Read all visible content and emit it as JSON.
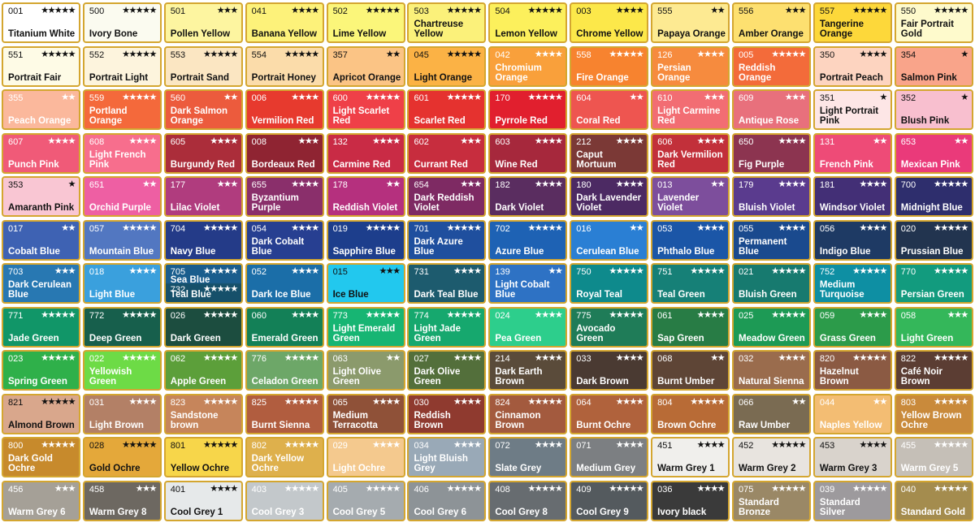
{
  "swatches": [
    {
      "code": "001",
      "stars": "★★★★★",
      "name": "Titanium White",
      "color": "#ffffff",
      "text": "light"
    },
    {
      "code": "500",
      "stars": "★★★★★",
      "name": "Ivory Bone",
      "color": "#fbfbf0",
      "text": "light"
    },
    {
      "code": "501",
      "stars": "★★★",
      "name": "Pollen Yellow",
      "color": "#fdf5a0",
      "text": "light"
    },
    {
      "code": "041",
      "stars": "★★★★",
      "name": "Banana Yellow",
      "color": "#fdf27a",
      "text": "light"
    },
    {
      "code": "502",
      "stars": "★★★★★",
      "name": "Lime Yellow",
      "color": "#fbf67a",
      "text": "light"
    },
    {
      "code": "503",
      "stars": "★★★★★",
      "name": "Chartreuse Yellow",
      "color": "#fbf17a",
      "text": "light"
    },
    {
      "code": "504",
      "stars": "★★★★★",
      "name": "Lemon Yellow",
      "color": "#fcf05c",
      "text": "light"
    },
    {
      "code": "003",
      "stars": "★★★★",
      "name": "Chrome Yellow",
      "color": "#fce84a",
      "text": "light"
    },
    {
      "code": "555",
      "stars": "★★",
      "name": "Papaya Orange",
      "color": "#fdea92",
      "text": "light"
    },
    {
      "code": "556",
      "stars": "★★★",
      "name": "Amber Orange",
      "color": "#fde070",
      "text": "light"
    },
    {
      "code": "557",
      "stars": "★★★★★",
      "name": "Tangerine Orange",
      "color": "#fdd83a",
      "text": "light"
    },
    {
      "code": "550",
      "stars": "★★★★★",
      "name": "Fair Portrait Gold",
      "color": "#fefacc",
      "text": "light"
    },
    {
      "code": "551",
      "stars": "★★★★★",
      "name": "Portrait Fair",
      "color": "#fefbe6",
      "text": "light"
    },
    {
      "code": "552",
      "stars": "★★★★★",
      "name": "Portrait Light",
      "color": "#fdf4dd",
      "text": "light"
    },
    {
      "code": "553",
      "stars": "★★★★★",
      "name": "Portrait Sand",
      "color": "#fbe6c2",
      "text": "light"
    },
    {
      "code": "554",
      "stars": "★★★★★",
      "name": "Portrait Honey",
      "color": "#fbdcaa",
      "text": "light"
    },
    {
      "code": "357",
      "stars": "★★",
      "name": "Apricot Orange",
      "color": "#fbc485",
      "text": "light"
    },
    {
      "code": "045",
      "stars": "★★★★★",
      "name": "Light Orange",
      "color": "#fbb245",
      "text": "light"
    },
    {
      "code": "042",
      "stars": "★★★★",
      "name": "Chromium Orange",
      "color": "#f9a03b",
      "text": "dark"
    },
    {
      "code": "558",
      "stars": "★★★★★",
      "name": "Fire Orange",
      "color": "#f7832f",
      "text": "dark"
    },
    {
      "code": "126",
      "stars": "★★★★",
      "name": "Persian Orange",
      "color": "#f68b3e",
      "text": "dark"
    },
    {
      "code": "005",
      "stars": "★★★★★",
      "name": "Reddish Orange",
      "color": "#f36b3a",
      "text": "dark"
    },
    {
      "code": "350",
      "stars": "★★★★",
      "name": "Portrait Peach",
      "color": "#fdd4c0",
      "text": "light"
    },
    {
      "code": "354",
      "stars": "★",
      "name": "Salmon Pink",
      "color": "#f9a48a",
      "text": "light"
    },
    {
      "code": "355",
      "stars": "★★",
      "name": "Peach Orange",
      "color": "#fbb89c",
      "text": "dark"
    },
    {
      "code": "559",
      "stars": "★★★★★",
      "name": "Portland Orange",
      "color": "#f4693b",
      "text": "dark"
    },
    {
      "code": "560",
      "stars": "★★",
      "name": "Dark Salmon Orange",
      "color": "#ec5b3d",
      "text": "dark"
    },
    {
      "code": "006",
      "stars": "★★★★",
      "name": "Vermilion Red",
      "color": "#e73a2e",
      "text": "dark"
    },
    {
      "code": "600",
      "stars": "★★★★★",
      "name": "Light Scarlet Red",
      "color": "#ef4048",
      "text": "dark"
    },
    {
      "code": "601",
      "stars": "★★★★★",
      "name": "Scarlet Red",
      "color": "#e5322f",
      "text": "dark"
    },
    {
      "code": "170",
      "stars": "★★★★★",
      "name": "Pyrrole Red",
      "color": "#e11f2e",
      "text": "dark"
    },
    {
      "code": "604",
      "stars": "★★",
      "name": "Coral Red",
      "color": "#ee5550",
      "text": "dark"
    },
    {
      "code": "610",
      "stars": "★★★",
      "name": "Light Carmine Red",
      "color": "#f26d73",
      "text": "dark"
    },
    {
      "code": "609",
      "stars": "★★★",
      "name": "Antique Rose",
      "color": "#e8707c",
      "text": "dark"
    },
    {
      "code": "351",
      "stars": "★",
      "name": "Light Portrait Pink",
      "color": "#fde6e6",
      "text": "light"
    },
    {
      "code": "352",
      "stars": "★",
      "name": "Blush Pink",
      "color": "#f8bfcf",
      "text": "light"
    },
    {
      "code": "607",
      "stars": "★★★★",
      "name": "Punch Pink",
      "color": "#f05a78",
      "text": "dark"
    },
    {
      "code": "608",
      "stars": "★★★★",
      "name": "Light French Pink",
      "color": "#f76e8d",
      "text": "dark"
    },
    {
      "code": "605",
      "stars": "★★★★",
      "name": "Burgundy Red",
      "color": "#ab2d3a",
      "text": "dark"
    },
    {
      "code": "008",
      "stars": "★★★",
      "name": "Bordeaux Red",
      "color": "#8f2432",
      "text": "dark"
    },
    {
      "code": "132",
      "stars": "★★★★",
      "name": "Carmine Red",
      "color": "#c92b45",
      "text": "dark"
    },
    {
      "code": "602",
      "stars": "★★★",
      "name": "Currant Red",
      "color": "#c72d3e",
      "text": "dark"
    },
    {
      "code": "603",
      "stars": "★★★★",
      "name": "Wine Red",
      "color": "#a6283c",
      "text": "dark"
    },
    {
      "code": "212",
      "stars": "★★★★",
      "name": "Caput Mortuum",
      "color": "#7b3936",
      "text": "dark"
    },
    {
      "code": "606",
      "stars": "★★★★",
      "name": "Dark Vermilion Red",
      "color": "#c2303a",
      "text": "dark"
    },
    {
      "code": "650",
      "stars": "★★★★",
      "name": "Fig Purple",
      "color": "#8c3450",
      "text": "dark"
    },
    {
      "code": "131",
      "stars": "★★",
      "name": "French Pink",
      "color": "#ee4b77",
      "text": "dark"
    },
    {
      "code": "653",
      "stars": "★★",
      "name": "Mexican Pink",
      "color": "#ea3a7a",
      "text": "dark"
    },
    {
      "code": "353",
      "stars": "★",
      "name": "Amaranth Pink",
      "color": "#f9c6d3",
      "text": "light"
    },
    {
      "code": "651",
      "stars": "★★",
      "name": "Orchid Purple",
      "color": "#ee5fa3",
      "text": "dark"
    },
    {
      "code": "177",
      "stars": "★★★",
      "name": "Lilac Violet",
      "color": "#b03c7e",
      "text": "dark"
    },
    {
      "code": "655",
      "stars": "★★★★",
      "name": "Byzantium Purple",
      "color": "#8a2f6b",
      "text": "dark"
    },
    {
      "code": "178",
      "stars": "★★",
      "name": "Reddish Violet",
      "color": "#b5307e",
      "text": "dark"
    },
    {
      "code": "654",
      "stars": "★★★",
      "name": "Dark Reddish Violet",
      "color": "#7e2a63",
      "text": "dark"
    },
    {
      "code": "182",
      "stars": "★★★★",
      "name": "Dark Violet",
      "color": "#5a2d60",
      "text": "dark"
    },
    {
      "code": "180",
      "stars": "★★★★",
      "name": "Dark Lavender Violet",
      "color": "#4c2a63",
      "text": "dark"
    },
    {
      "code": "013",
      "stars": "★★",
      "name": "Lavender Violet",
      "color": "#7d4e9c",
      "text": "dark"
    },
    {
      "code": "179",
      "stars": "★★★★",
      "name": "Bluish Violet",
      "color": "#5a3b8e",
      "text": "dark"
    },
    {
      "code": "181",
      "stars": "★★★★",
      "name": "Windsor Violet",
      "color": "#432f76",
      "text": "dark"
    },
    {
      "code": "700",
      "stars": "★★★★★",
      "name": "Midnight Blue",
      "color": "#2e2e6d",
      "text": "dark"
    },
    {
      "code": "017",
      "stars": "★★",
      "name": "Cobalt Blue",
      "color": "#3e62b3",
      "text": "dark"
    },
    {
      "code": "057",
      "stars": "★★★★★",
      "name": "Mountain Blue",
      "color": "#5277c1",
      "text": "dark"
    },
    {
      "code": "704",
      "stars": "★★★★★",
      "name": "Navy Blue",
      "color": "#243b88",
      "text": "dark"
    },
    {
      "code": "054",
      "stars": "★★★★",
      "name": "Dark Cobalt Blue",
      "color": "#273f91",
      "text": "dark"
    },
    {
      "code": "019",
      "stars": "★★★★★",
      "name": "Sapphire Blue",
      "color": "#1d3e8c",
      "text": "dark"
    },
    {
      "code": "701",
      "stars": "★★★★★",
      "name": "Dark Azure Blue",
      "color": "#1f4f9e",
      "text": "dark"
    },
    {
      "code": "702",
      "stars": "★★★★★",
      "name": "Azure Blue",
      "color": "#1e62b4",
      "text": "dark"
    },
    {
      "code": "016",
      "stars": "★★",
      "name": "Cerulean Blue",
      "color": "#2a7fd4",
      "text": "dark"
    },
    {
      "code": "053",
      "stars": "★★★★",
      "name": "Phthalo Blue",
      "color": "#1b56a7",
      "text": "dark"
    },
    {
      "code": "055",
      "stars": "★★★★",
      "name": "Permanent Blue",
      "color": "#1a4a8e",
      "text": "dark"
    },
    {
      "code": "056",
      "stars": "★★★★",
      "name": "Indigo Blue",
      "color": "#1e3a64",
      "text": "dark"
    },
    {
      "code": "020",
      "stars": "★★★★★",
      "name": "Prussian Blue",
      "color": "#22344f",
      "text": "dark"
    },
    {
      "code": "703",
      "stars": "★★★",
      "name": "Dark Cerulean Blue",
      "color": "#2878b2",
      "text": "dark"
    },
    {
      "code": "018",
      "stars": "★★★★",
      "name": "Light Blue",
      "color": "#3aa0dd",
      "text": "dark"
    },
    {
      "code": "705",
      "stars": "★★★★★",
      "name": "Sea Blue",
      "code2": "732",
      "stars2": "★★★★★",
      "name2": "Teal Blue",
      "color": "#1a5d8d",
      "color2": "#16506a",
      "text": "dark",
      "dual": true
    },
    {
      "code": "052",
      "stars": "★★★★",
      "name": "Dark Ice Blue",
      "color": "#1b6ea8",
      "text": "dark"
    },
    {
      "code": "015",
      "stars": "★★★",
      "name": "Ice Blue",
      "color": "#22c8ee",
      "text": "light"
    },
    {
      "code": "731",
      "stars": "★★★★",
      "name": "Dark Teal Blue",
      "color": "#1d5b6e",
      "text": "dark"
    },
    {
      "code": "139",
      "stars": "★★",
      "name": "Light Cobalt Blue",
      "color": "#2e72c4",
      "text": "dark"
    },
    {
      "code": "750",
      "stars": "★★★★★",
      "name": "Royal Teal",
      "color": "#0e8a8c",
      "text": "dark"
    },
    {
      "code": "751",
      "stars": "★★★★★",
      "name": "Teal Green",
      "color": "#168077",
      "text": "dark"
    },
    {
      "code": "021",
      "stars": "★★★★★",
      "name": "Bluish Green",
      "color": "#177a6f",
      "text": "dark"
    },
    {
      "code": "752",
      "stars": "★★★★★",
      "name": "Medium Turquoise",
      "color": "#0e8fa3",
      "text": "dark"
    },
    {
      "code": "770",
      "stars": "★★★★★",
      "name": "Persian Green",
      "color": "#129b7e",
      "text": "dark"
    },
    {
      "code": "771",
      "stars": "★★★★★",
      "name": "Jade Green",
      "color": "#119668",
      "text": "dark"
    },
    {
      "code": "772",
      "stars": "★★★★★",
      "name": "Deep Green",
      "color": "#175f4c",
      "text": "dark"
    },
    {
      "code": "026",
      "stars": "★★★★★",
      "name": "Dark Green",
      "color": "#1c4d3f",
      "text": "dark"
    },
    {
      "code": "060",
      "stars": "★★★★",
      "name": "Emerald Green",
      "color": "#138057",
      "text": "dark"
    },
    {
      "code": "773",
      "stars": "★★★★★",
      "name": "Light Emerald Green",
      "color": "#17b573",
      "text": "dark"
    },
    {
      "code": "774",
      "stars": "★★★★★",
      "name": "Light Jade Green",
      "color": "#16a86e",
      "text": "dark"
    },
    {
      "code": "024",
      "stars": "★★★★",
      "name": "Pea Green",
      "color": "#2dce8c",
      "text": "dark"
    },
    {
      "code": "775",
      "stars": "★★★★★",
      "name": "Avocado Green",
      "color": "#1f7c58",
      "text": "dark"
    },
    {
      "code": "061",
      "stars": "★★★★",
      "name": "Sap Green",
      "color": "#287c45",
      "text": "dark"
    },
    {
      "code": "025",
      "stars": "★★★★★",
      "name": "Meadow Green",
      "color": "#1d9a55",
      "text": "dark"
    },
    {
      "code": "059",
      "stars": "★★★★",
      "name": "Grass Green",
      "color": "#2c9b4a",
      "text": "dark"
    },
    {
      "code": "058",
      "stars": "★★★",
      "name": "Light Green",
      "color": "#34b75a",
      "text": "dark"
    },
    {
      "code": "023",
      "stars": "★★★★★",
      "name": "Spring Green",
      "color": "#2fb04a",
      "text": "dark"
    },
    {
      "code": "022",
      "stars": "★★★★★",
      "name": "Yellowish Green",
      "color": "#6ddb46",
      "text": "dark"
    },
    {
      "code": "062",
      "stars": "★★★★★",
      "name": "Apple Green",
      "color": "#5c9f3a",
      "text": "dark"
    },
    {
      "code": "776",
      "stars": "★★★★★",
      "name": "Celadon Green",
      "color": "#6da768",
      "text": "dark"
    },
    {
      "code": "063",
      "stars": "★★",
      "name": "Light  Olive Green",
      "color": "#8b9a6c",
      "text": "dark"
    },
    {
      "code": "027",
      "stars": "★★★★",
      "name": "Dark Olive Green",
      "color": "#536f3b",
      "text": "dark"
    },
    {
      "code": "214",
      "stars": "★★★★",
      "name": "Dark Earth Brown",
      "color": "#5a4b3a",
      "text": "dark"
    },
    {
      "code": "033",
      "stars": "★★★★",
      "name": "Dark Brown",
      "color": "#4a3a32",
      "text": "dark"
    },
    {
      "code": "068",
      "stars": "★★",
      "name": "Burnt Umber",
      "color": "#5e4536",
      "text": "dark"
    },
    {
      "code": "032",
      "stars": "★★★★",
      "name": "Natural Sienna",
      "color": "#9a6c4d",
      "text": "dark"
    },
    {
      "code": "820",
      "stars": "★★★★★",
      "name": "Hazelnut Brown",
      "color": "#8b5a43",
      "text": "dark"
    },
    {
      "code": "822",
      "stars": "★★★★★",
      "name": "Café Noir Brown",
      "color": "#5b3d33",
      "text": "dark"
    },
    {
      "code": "821",
      "stars": "★★★★★",
      "name": "Almond Brown",
      "color": "#d9a78c",
      "text": "light"
    },
    {
      "code": "031",
      "stars": "★★★★",
      "name": "Light Brown",
      "color": "#b38066",
      "text": "dark"
    },
    {
      "code": "823",
      "stars": "★★★★★",
      "name": "Sandstone brown",
      "color": "#c6855b",
      "text": "dark"
    },
    {
      "code": "825",
      "stars": "★★★★★",
      "name": "Burnt Sienna",
      "color": "#b15d3f",
      "text": "dark"
    },
    {
      "code": "065",
      "stars": "★★★★",
      "name": "Medium Terracotta",
      "color": "#8f5138",
      "text": "dark"
    },
    {
      "code": "030",
      "stars": "★★★★",
      "name": "Reddish Brown",
      "color": "#8f3a2f",
      "text": "dark"
    },
    {
      "code": "824",
      "stars": "★★★★★",
      "name": "Cinnamon Brown",
      "color": "#a35a3e",
      "text": "dark"
    },
    {
      "code": "064",
      "stars": "★★★★",
      "name": "Burnt Ochre",
      "color": "#b0623c",
      "text": "dark"
    },
    {
      "code": "804",
      "stars": "★★★★★",
      "name": "Brown Ochre",
      "color": "#b86b36",
      "text": "dark"
    },
    {
      "code": "066",
      "stars": "★★",
      "name": "Raw Umber",
      "color": "#7a6b52",
      "text": "dark"
    },
    {
      "code": "044",
      "stars": "★★",
      "name": "Naples Yellow",
      "color": "#f3bd73",
      "text": "dark"
    },
    {
      "code": "803",
      "stars": "★★★★★",
      "name": "Yellow Brown Ochre",
      "color": "#c98a3b",
      "text": "dark"
    },
    {
      "code": "800",
      "stars": "★★★★★",
      "name": "Dark Gold Ochre",
      "color": "#c78a2c",
      "text": "dark"
    },
    {
      "code": "028",
      "stars": "★★★★★",
      "name": "Gold Ochre",
      "color": "#e4a83a",
      "text": "light"
    },
    {
      "code": "801",
      "stars": "★★★★★",
      "name": "Yellow Ochre",
      "color": "#f7d64a",
      "text": "light"
    },
    {
      "code": "802",
      "stars": "★★★★★",
      "name": "Dark Yellow Ochre",
      "color": "#deb04c",
      "text": "dark"
    },
    {
      "code": "029",
      "stars": "★★★★",
      "name": "Light Ochre",
      "color": "#f4c98e",
      "text": "dark"
    },
    {
      "code": "034",
      "stars": "★★★★",
      "name": "Light Bluish Grey",
      "color": "#99a9b7",
      "text": "dark"
    },
    {
      "code": "072",
      "stars": "★★★★",
      "name": "Slate Grey",
      "color": "#6e7c86",
      "text": "dark"
    },
    {
      "code": "071",
      "stars": "★★★★",
      "name": "Medium Grey",
      "color": "#7c7f82",
      "text": "dark"
    },
    {
      "code": "451",
      "stars": "★★★★",
      "name": "Warm Grey 1",
      "color": "#f0efec",
      "text": "light"
    },
    {
      "code": "452",
      "stars": "★★★★★",
      "name": "Warm Grey 2",
      "color": "#e8e4df",
      "text": "light"
    },
    {
      "code": "453",
      "stars": "★★★★",
      "name": "Warm Grey 3",
      "color": "#d9d3cc",
      "text": "light"
    },
    {
      "code": "455",
      "stars": "★★★★★",
      "name": "Warm Grey 5",
      "color": "#c5bfb7",
      "text": "dark"
    },
    {
      "code": "456",
      "stars": "★★★",
      "name": "Warm Grey 6",
      "color": "#a5a097",
      "text": "dark"
    },
    {
      "code": "458",
      "stars": "★★★",
      "name": "Warm Grey 8",
      "color": "#6d6861",
      "text": "dark"
    },
    {
      "code": "401",
      "stars": "★★★★",
      "name": "Cool Grey 1",
      "color": "#e6e9ea",
      "text": "light"
    },
    {
      "code": "403",
      "stars": "★★★★★",
      "name": "Cool Grey 3",
      "color": "#c3c8cb",
      "text": "dark"
    },
    {
      "code": "405",
      "stars": "★★★★★",
      "name": "Cool Grey 5",
      "color": "#a5abaf",
      "text": "dark"
    },
    {
      "code": "406",
      "stars": "★★★★★",
      "name": "Cool Grey 6",
      "color": "#8d9397",
      "text": "dark"
    },
    {
      "code": "408",
      "stars": "★★★★★",
      "name": "Cool Grey 8",
      "color": "#676c70",
      "text": "dark"
    },
    {
      "code": "409",
      "stars": "★★★★★",
      "name": "Cool Grey 9",
      "color": "#545a5e",
      "text": "dark"
    },
    {
      "code": "036",
      "stars": "★★★★",
      "name": "Ivory black",
      "color": "#3a3a3a",
      "text": "dark"
    },
    {
      "code": "075",
      "stars": "★★★★★",
      "name": "Standard Bronze",
      "color": "#9a8866",
      "text": "dark"
    },
    {
      "code": "039",
      "stars": "★★★★★",
      "name": "Standard Silver",
      "color": "#9d9a9d",
      "text": "dark"
    },
    {
      "code": "040",
      "stars": "★★★★★",
      "name": "Standard Gold",
      "color": "#a48c4e",
      "text": "dark"
    }
  ]
}
